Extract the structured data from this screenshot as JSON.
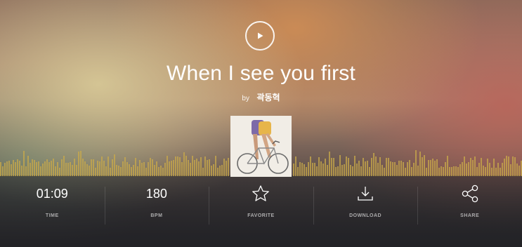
{
  "track": {
    "title": "When I see you first",
    "by_label": "by",
    "artist": "곽동혁"
  },
  "stats": {
    "time": {
      "value": "01:09",
      "label": "TIME"
    },
    "bpm": {
      "value": "180",
      "label": "BPM"
    },
    "favorite": {
      "label": "FAVORITE"
    },
    "download": {
      "label": "DOWNLOAD"
    },
    "share": {
      "label": "SHARE"
    }
  },
  "icons": {
    "play": "play-icon",
    "favorite": "star-icon",
    "download": "download-icon",
    "share": "share-icon"
  },
  "colors": {
    "waveform": "#c9a94a",
    "text": "#ffffff"
  }
}
